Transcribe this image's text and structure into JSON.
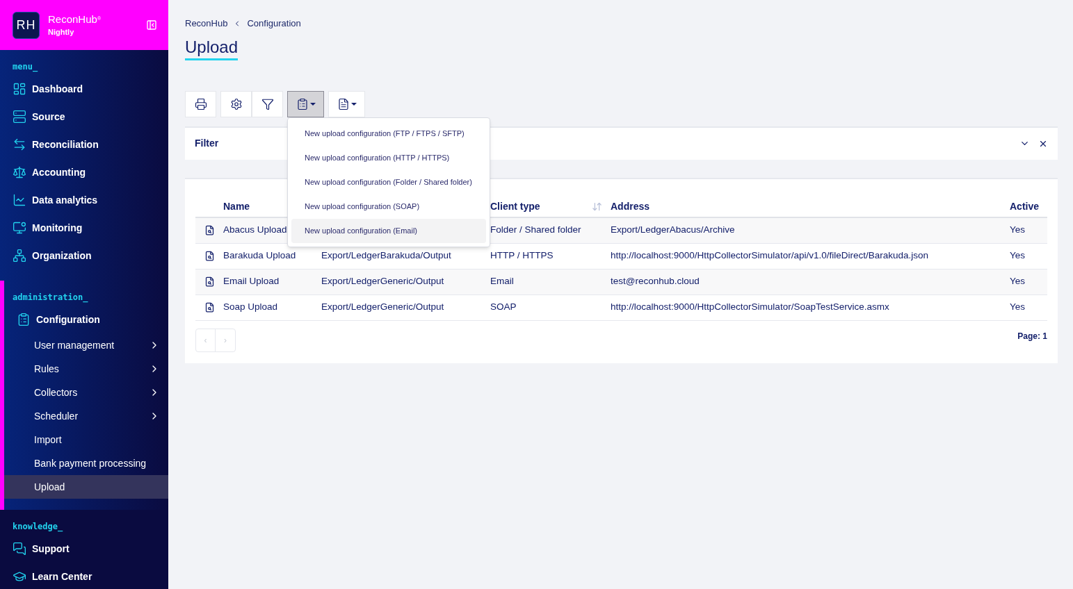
{
  "sidebar": {
    "logo": {
      "initials": "RH",
      "name": "ReconHub",
      "mark": "®",
      "edition": "Nightly"
    },
    "sections": [
      {
        "title": "menu_",
        "items": [
          {
            "label": "Dashboard",
            "selected": false
          },
          {
            "label": "Source",
            "selected": false
          },
          {
            "label": "Reconciliation",
            "selected": false
          },
          {
            "label": "Accounting",
            "selected": false
          },
          {
            "label": "Data analytics",
            "selected": false
          },
          {
            "label": "Monitoring",
            "selected": false
          },
          {
            "label": "Organization",
            "selected": false
          }
        ]
      },
      {
        "title": "administration_",
        "items": [
          {
            "label": "Configuration",
            "selected": false,
            "children": [
              {
                "label": "User management",
                "selected": false,
                "has_submenu": true
              },
              {
                "label": "Rules",
                "selected": false,
                "has_submenu": true
              },
              {
                "label": "Collectors",
                "selected": false,
                "has_submenu": true
              },
              {
                "label": "Scheduler",
                "selected": false,
                "has_submenu": true
              },
              {
                "label": "Import",
                "selected": false,
                "has_submenu": false
              },
              {
                "label": "Bank payment processing",
                "selected": false,
                "has_submenu": false
              },
              {
                "label": "Upload",
                "selected": true,
                "has_submenu": false
              }
            ]
          }
        ]
      },
      {
        "title": "knowledge_",
        "items": [
          {
            "label": "Support",
            "selected": false
          },
          {
            "label": "Learn Center",
            "selected": false
          }
        ]
      }
    ]
  },
  "breadcrumb": [
    "ReconHub",
    "Configuration"
  ],
  "page_title": "Upload",
  "toolbar": [
    {
      "selected": false,
      "dropdown": false
    },
    {
      "selected": false,
      "dropdown": false
    },
    {
      "selected": false,
      "dropdown": false
    },
    {
      "selected": true,
      "dropdown": true
    },
    {
      "selected": false,
      "dropdown": true
    }
  ],
  "dropdown_menu": [
    {
      "label": "New upload configuration (FTP / FTPS / SFTP)",
      "selected": false
    },
    {
      "label": "New upload configuration (HTTP / HTTPS)",
      "selected": false
    },
    {
      "label": "New upload configuration (Folder / Shared folder)",
      "selected": false
    },
    {
      "label": "New upload configuration (SOAP)",
      "selected": false
    },
    {
      "label": "New upload configuration (Email)",
      "selected": true
    }
  ],
  "filter": {
    "title": "Filter",
    "expanded": false
  },
  "table": {
    "columns": [
      "Name",
      "Client type",
      "Address",
      "Active"
    ],
    "rows": [
      {
        "name": "Abacus Upload",
        "client_type": "Folder / Shared folder",
        "address": "Export/LedgerAbacus/Archive",
        "active": "Yes"
      },
      {
        "name": "Barakuda Upload",
        "column_2": "Export/LedgerBarakuda/Output",
        "client_type": "HTTP / HTTPS",
        "address": "http://localhost:9000/HttpCollectorSimulator/api/v1.0/fileDirect/Barakuda.json",
        "active": "Yes"
      },
      {
        "name": "Email Upload",
        "column_2": "Export/LedgerGeneric/Output",
        "client_type": "Email",
        "address": "test@reconhub.cloud",
        "active": "Yes"
      },
      {
        "name": "Soap Upload",
        "column_2": "Export/LedgerGeneric/Output",
        "client_type": "SOAP",
        "address": "http://localhost:9000/HttpCollectorSimulator/SoapTestService.asmx",
        "active": "Yes"
      }
    ],
    "pager": {
      "prev": "‹",
      "next": "›",
      "page": "Page: 1"
    }
  }
}
